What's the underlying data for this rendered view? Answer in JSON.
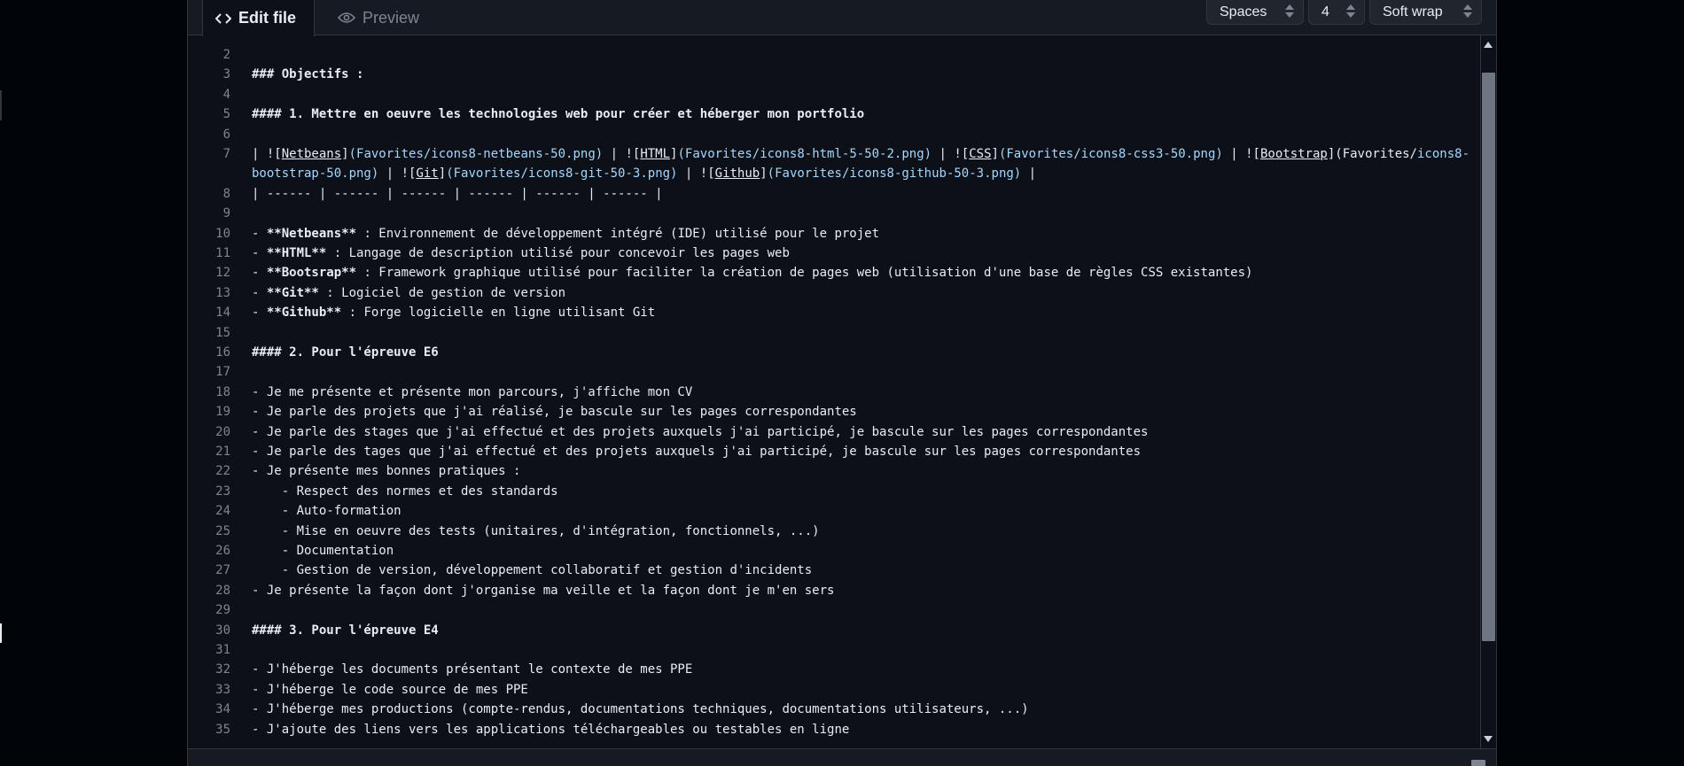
{
  "header": {
    "tab_edit_label": "Edit file",
    "tab_preview_label": "Preview",
    "indent_mode": "Spaces",
    "indent_size": "4",
    "wrap_mode": "Soft wrap"
  },
  "colors": {
    "background": "#0d1117",
    "text": "#e6edf3",
    "link_text": "#a5d6ff",
    "line_number": "#7d8590",
    "border": "#30363d"
  },
  "lines": [
    {
      "n": "2",
      "t": ""
    },
    {
      "n": "3",
      "t": "### Objectifs :"
    },
    {
      "n": "4",
      "t": ""
    },
    {
      "n": "5",
      "t": "#### 1. Mettre en oeuvre les technologies web pour créer et héberger mon portfolio"
    },
    {
      "n": "6",
      "t": ""
    },
    {
      "n": "7",
      "t": "| ![Netbeans](Favorites/icons8-netbeans-50.png) | ![HTML](Favorites/icons8-html-5-50-2.png) | ![CSS](Favorites/icons8-css3-50.png) | ![Bootstrap](Favorites/icons8-"
    },
    {
      "n": "",
      "t": "bootstrap-50.png) | ![Git](Favorites/icons8-git-50-3.png) | ![Github](Favorites/icons8-github-50-3.png) |"
    },
    {
      "n": "8",
      "t": "| ------ | ------ | ------ | ------ | ------ | ------ |"
    },
    {
      "n": "9",
      "t": ""
    },
    {
      "n": "10",
      "t": "- **Netbeans** : Environnement de développement intégré (IDE) utilisé pour le projet"
    },
    {
      "n": "11",
      "t": "- **HTML** : Langage de description utilisé pour concevoir les pages web"
    },
    {
      "n": "12",
      "t": "- **Bootsrap** : Framework graphique utilisé pour faciliter la création de pages web (utilisation d'une base de règles CSS existantes)"
    },
    {
      "n": "13",
      "t": "- **Git** : Logiciel de gestion de version"
    },
    {
      "n": "14",
      "t": "- **Github** : Forge logicielle en ligne utilisant Git"
    },
    {
      "n": "15",
      "t": ""
    },
    {
      "n": "16",
      "t": "#### 2. Pour l'épreuve E6"
    },
    {
      "n": "17",
      "t": ""
    },
    {
      "n": "18",
      "t": "- Je me présente et présente mon parcours, j'affiche mon CV"
    },
    {
      "n": "19",
      "t": "- Je parle des projets que j'ai réalisé, je bascule sur les pages correspondantes"
    },
    {
      "n": "20",
      "t": "- Je parle des stages que j'ai effectué et des projets auxquels j'ai participé, je bascule sur les pages correspondantes"
    },
    {
      "n": "21",
      "t": "- Je parle des tages que j'ai effectué et des projets auxquels j'ai participé, je bascule sur les pages correspondantes"
    },
    {
      "n": "22",
      "t": "- Je présente mes bonnes pratiques :"
    },
    {
      "n": "23",
      "t": "    - Respect des normes et des standards"
    },
    {
      "n": "24",
      "t": "    - Auto-formation"
    },
    {
      "n": "25",
      "t": "    - Mise en oeuvre des tests (unitaires, d'intégration, fonctionnels, ...)"
    },
    {
      "n": "26",
      "t": "    - Documentation"
    },
    {
      "n": "27",
      "t": "    - Gestion de version, développement collaboratif et gestion d'incidents"
    },
    {
      "n": "28",
      "t": "- Je présente la façon dont j'organise ma veille et la façon dont je m'en sers"
    },
    {
      "n": "29",
      "t": ""
    },
    {
      "n": "30",
      "t": "#### 3. Pour l'épreuve E4"
    },
    {
      "n": "31",
      "t": ""
    },
    {
      "n": "32",
      "t": "- J'héberge les documents présentant le contexte de mes PPE"
    },
    {
      "n": "33",
      "t": "- J'héberge le code source de mes PPE"
    },
    {
      "n": "34",
      "t": "- J'héberge mes productions (compte-rendus, documentations techniques, documentations utilisateurs, ...)"
    },
    {
      "n": "35",
      "t": "- J'ajoute des liens vers les applications téléchargeables ou testables en ligne"
    }
  ]
}
